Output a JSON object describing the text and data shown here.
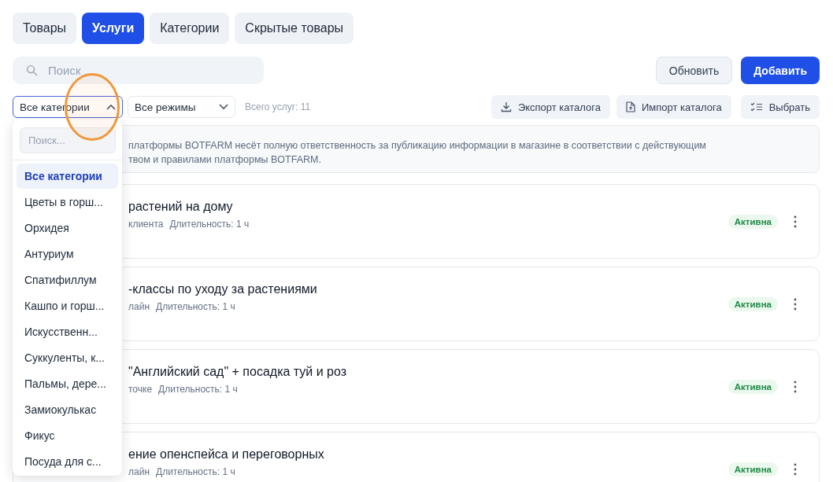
{
  "tabs": [
    {
      "label": "Товары",
      "selected": false
    },
    {
      "label": "Услуги",
      "selected": true
    },
    {
      "label": "Категории",
      "selected": false
    },
    {
      "label": "Скрытые товары",
      "selected": false
    }
  ],
  "search": {
    "placeholder": "Поиск"
  },
  "actions": [
    {
      "label": "Обновить",
      "kind": "secondary"
    },
    {
      "label": "Добавить",
      "kind": "primary"
    }
  ],
  "category_select": {
    "value": "Все категории",
    "expanded": true
  },
  "mode_select": {
    "value": "Все режимы",
    "expanded": false
  },
  "total": "Всего услуг: 11",
  "tools": [
    {
      "label": "Экспорт каталога",
      "kind": "download"
    },
    {
      "label": "Импорт каталога",
      "kind": "import"
    },
    {
      "label": "Выбрать",
      "kind": "checklist"
    }
  ],
  "notice": "платформы BOTFARM несёт полную ответственность за публикацию информации в магазине в соответствии с действующим\nтвом и правилами платформы BOTFARM.",
  "services": [
    {
      "title": "растений на дому",
      "place": "клиента",
      "duration": "Длительность: 1 ч",
      "status": "Активна",
      "active": true
    },
    {
      "title": "-классы по уходу за растениями",
      "place": "лайн",
      "duration": "Длительность: 1 ч",
      "status": "Активна",
      "active": true
    },
    {
      "title": "\"Английский сад\" + посадка туй и роз",
      "place": "точке",
      "duration": "Длительность: 1 ч",
      "status": "Активна",
      "active": true
    },
    {
      "title": "ение опенспейса и переговорных",
      "place": "лайн",
      "duration": "Длительность: 1 ч",
      "status": "Активна",
      "active": true
    }
  ],
  "dropdown": {
    "search_placeholder": "Поиск...",
    "options": [
      {
        "label": "Все категории",
        "selected": true
      },
      {
        "label": "Цветы в горш...",
        "selected": false
      },
      {
        "label": "Орхидея",
        "selected": false
      },
      {
        "label": "Антуриум",
        "selected": false
      },
      {
        "label": "Спатифиллум",
        "selected": false
      },
      {
        "label": "Кашпо и горш...",
        "selected": false
      },
      {
        "label": "Искусственн...",
        "selected": false
      },
      {
        "label": "Суккуленты, к...",
        "selected": false
      },
      {
        "label": "Пальмы, дере...",
        "selected": false
      },
      {
        "label": "Замиокулькас",
        "selected": false
      },
      {
        "label": "Фикус",
        "selected": false
      },
      {
        "label": "Посуда для с...",
        "selected": false
      }
    ]
  }
}
